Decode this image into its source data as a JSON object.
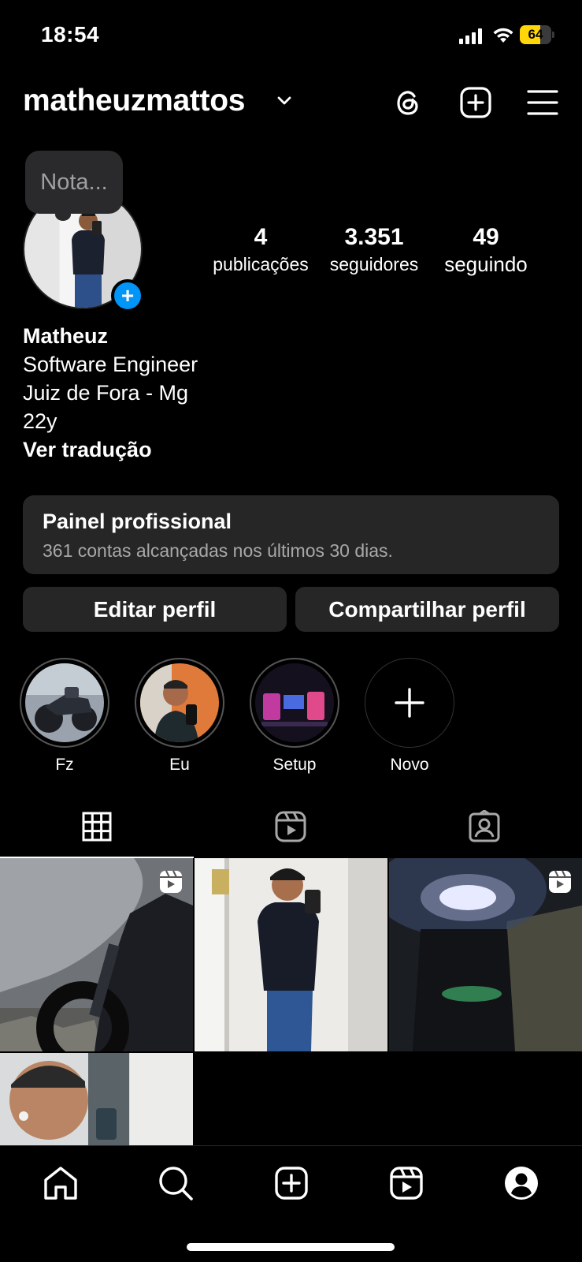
{
  "status_bar": {
    "time": "18:54",
    "battery_level": 64,
    "battery_text": "64"
  },
  "header": {
    "username": "matheuzmattos",
    "icons": [
      "chevron-down-icon",
      "threads-icon",
      "create-post-icon",
      "menu-icon"
    ]
  },
  "profile": {
    "note_placeholder": "Nota...",
    "stats": [
      {
        "value": "4",
        "label": "publicações"
      },
      {
        "value": "3.351",
        "label": "seguidores"
      },
      {
        "value": "49",
        "label": "seguindo"
      }
    ],
    "name": "Matheuz",
    "bio_lines": [
      "Software Engineer",
      "Juiz de Fora - Mg",
      "22y"
    ],
    "translate_label": "Ver tradução"
  },
  "professional_panel": {
    "title": "Painel profissional",
    "subtitle": "361 contas alcançadas nos últimos 30 dias."
  },
  "actions": {
    "edit_label": "Editar perfil",
    "share_label": "Compartilhar perfil"
  },
  "highlights": [
    {
      "label": "Fz"
    },
    {
      "label": "Eu"
    },
    {
      "label": "Setup"
    },
    {
      "label": "Novo"
    }
  ],
  "tabs": [
    "grid-icon",
    "reels-icon",
    "tagged-icon"
  ],
  "nav": [
    "home-icon",
    "search-icon",
    "create-icon",
    "reels-icon",
    "profile-icon"
  ],
  "colors": {
    "accent": "#0095f6",
    "panel": "#262626",
    "battery": "#ffd60a"
  }
}
